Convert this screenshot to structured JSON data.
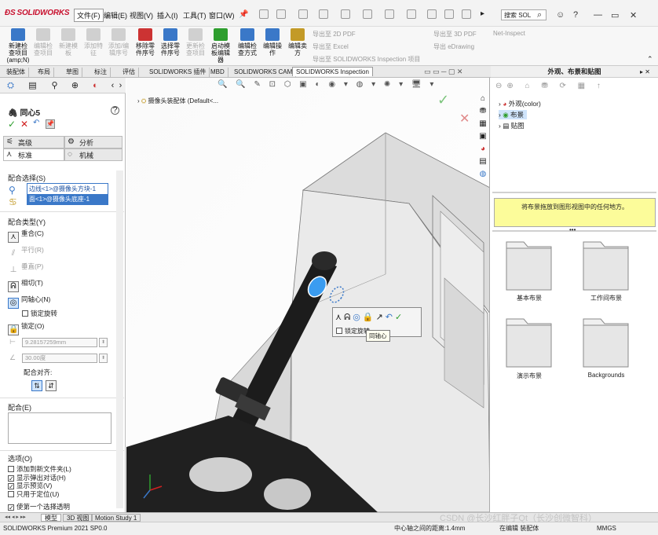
{
  "app": {
    "logo": "SOLIDWORKS",
    "menus": [
      "文件(F)",
      "编辑(E)",
      "视图(V)",
      "插入(I)",
      "工具(T)",
      "窗口(W)"
    ],
    "search_placeholder": "搜索 SOL"
  },
  "command_manager": {
    "buttons": [
      {
        "label": "新建检查项目(amp;N)",
        "enabled": true
      },
      {
        "label": "编辑检查项目",
        "enabled": false
      },
      {
        "label": "新建模板",
        "enabled": false
      },
      {
        "label": "添加特征",
        "enabled": false
      },
      {
        "label": "添加/编辑序号",
        "enabled": false
      },
      {
        "label": "移除零件序号",
        "enabled": true
      },
      {
        "label": "选择零件序号",
        "enabled": true
      },
      {
        "label": "更新检查项目",
        "enabled": false
      },
      {
        "label": "启动模板编辑器",
        "enabled": true
      },
      {
        "label": "编辑检查方式",
        "enabled": true
      },
      {
        "label": "编辑操作",
        "enabled": true
      },
      {
        "label": "编辑卖方",
        "enabled": true
      }
    ],
    "right_items": [
      "导出至 2D PDF",
      "导出至 Excel",
      "导出至 SOLIDWORKS Inspection 项目",
      "导出至 3D PDF",
      "导出 eDrawing",
      "Net-Inspect"
    ]
  },
  "tabs": [
    "装配体",
    "布局",
    "草图",
    "标注",
    "评估",
    "SOLIDWORKS 插件",
    "MBD",
    "SOLIDWORKS CAM",
    "SOLIDWORKS Inspection"
  ],
  "selected_tab": "SOLIDWORKS Inspection",
  "property_manager": {
    "title": "同心5",
    "subtabs": [
      "高级",
      "分析",
      "标准",
      "机械"
    ],
    "mate_selection_title": "配合选择(S)",
    "mate_selections": [
      "边线<1>@摄像头方块-1",
      "面<1>@摄像头底座-1"
    ],
    "mate_types_title": "配合类型(Y)",
    "mate_types": [
      {
        "label": "重合(C)",
        "enabled": true
      },
      {
        "label": "平行(R)",
        "enabled": false
      },
      {
        "label": "垂直(P)",
        "enabled": false
      },
      {
        "label": "相切(T)",
        "enabled": true
      },
      {
        "label": "同轴心(N)",
        "enabled": true
      }
    ],
    "lock_rotation": "锁定旋转",
    "lock": "锁定(O)",
    "distance": "9.28157259mm",
    "angle": "30.00度",
    "align": "配合对齐:",
    "mates_title": "配合(E)",
    "options_title": "选项(O)",
    "options": [
      {
        "label": "添加到新文件夹(L)",
        "checked": false
      },
      {
        "label": "显示弹出对话(H)",
        "checked": true
      },
      {
        "label": "显示预览(V)",
        "checked": true
      },
      {
        "label": "只用于定位(U)",
        "checked": false
      },
      {
        "label": "使第一个选择透明",
        "checked": true
      }
    ]
  },
  "viewport": {
    "tree_label": "摄像头装配体 (Default<...",
    "popup_lock_rotation": "锁定旋转",
    "tooltip": "同轴心"
  },
  "task_pane": {
    "title": "外观、布景和贴图",
    "tree": [
      "外观(color)",
      "布景",
      "贴图"
    ],
    "hint": "将布景拖放到图形视图中的任何地方。",
    "folders": [
      "基本布景",
      "工作间布景",
      "演示布景",
      "Backgrounds"
    ]
  },
  "bottom_tabs": [
    "模型",
    "3D 视图",
    "Motion Study 1"
  ],
  "status": {
    "app_version": "SOLIDWORKS Premium 2021 SP0.0",
    "distance_label": "中心轴之间的距离:",
    "distance_value": "1.4mm",
    "edit": "在编辑 装配体",
    "units": "MMGS",
    "watermark": "CSDN @长沙红胖子Qt（长沙创微智科）"
  },
  "colors": {
    "accent_blue": "#3a78c8",
    "hint_yellow": "#fcfc9a",
    "check_green": "#2e9e2e",
    "cancel_red": "#d02020"
  }
}
